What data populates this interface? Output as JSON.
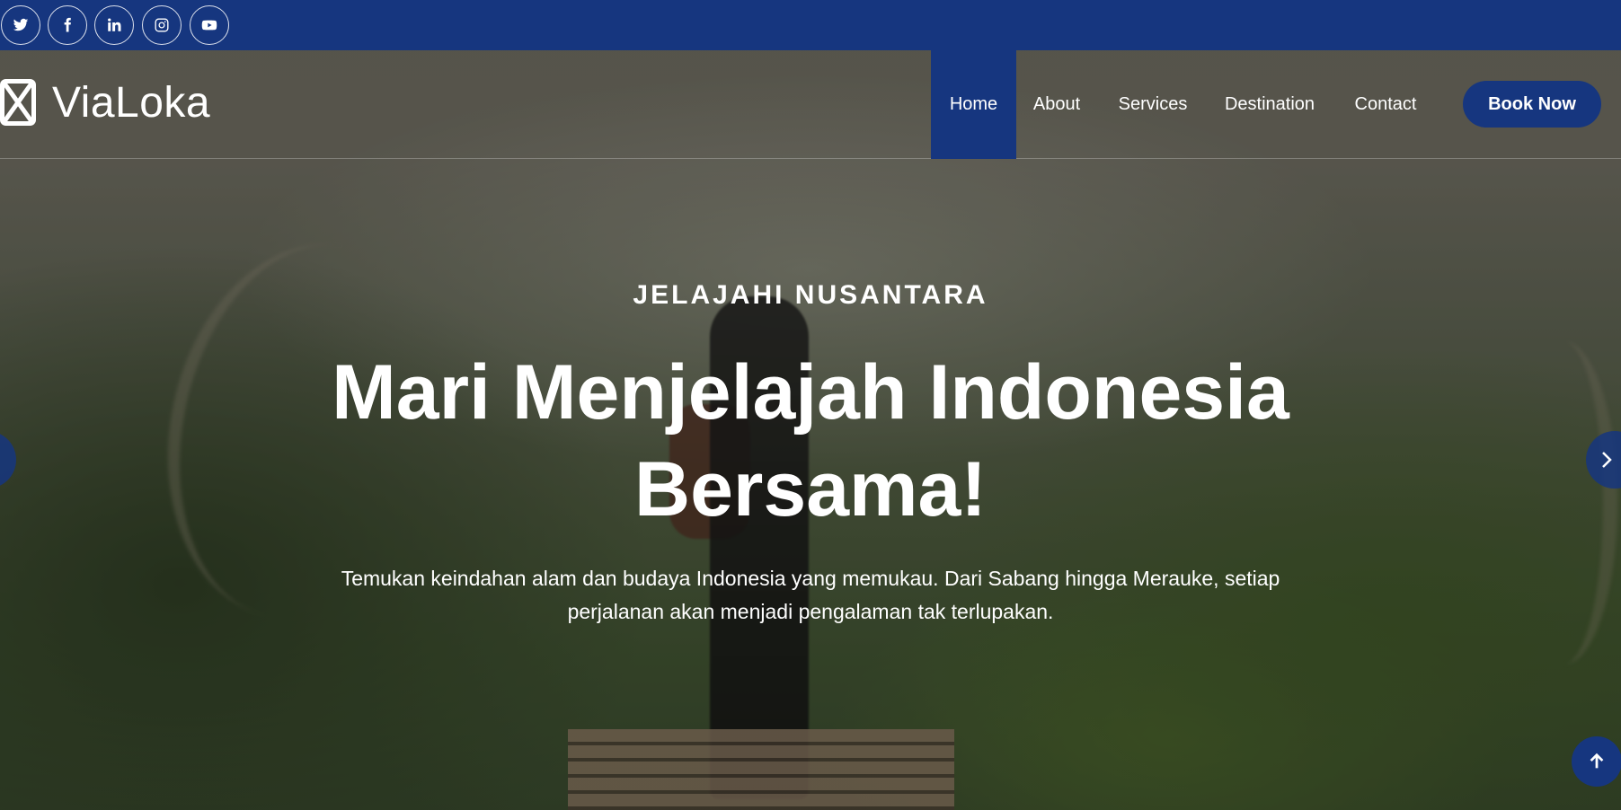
{
  "topbar": {
    "social": [
      {
        "icon": "twitter-icon"
      },
      {
        "icon": "facebook-icon"
      },
      {
        "icon": "linkedin-icon"
      },
      {
        "icon": "instagram-icon"
      },
      {
        "icon": "youtube-icon"
      }
    ]
  },
  "header": {
    "brand": "ViaLoka",
    "nav": [
      "Home",
      "About",
      "Services",
      "Destination",
      "Contact"
    ],
    "active_nav": "Home",
    "cta": "Book Now"
  },
  "hero": {
    "eyebrow": "JELAJAHI NUSANTARA",
    "headline": "Mari Menjelajah Indonesia Bersama!",
    "subtext": "Temukan keindahan alam dan budaya Indonesia yang memukau. Dari Sabang hingga Merauke, setiap perjalanan akan menjadi pengalaman tak terlupakan."
  },
  "colors": {
    "primary": "#16367f",
    "text": "#ffffff"
  }
}
